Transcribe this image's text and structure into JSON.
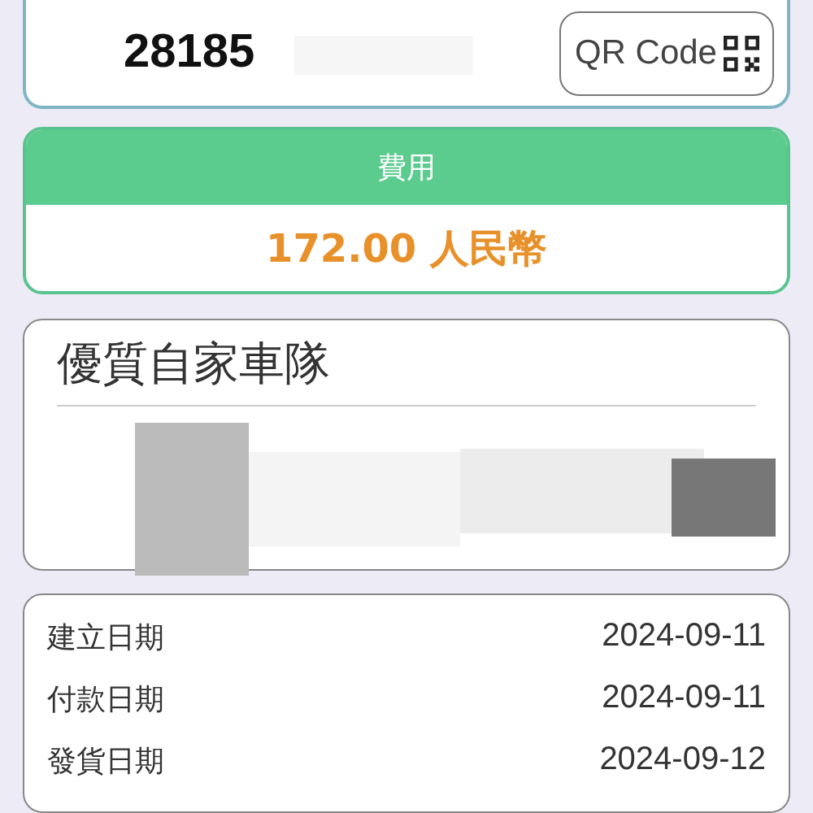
{
  "order": {
    "number": "28185",
    "qr_button": "QR Code"
  },
  "fee": {
    "title": "費用",
    "amount": "172.00 人民幣"
  },
  "carrier": {
    "title": "優質自家車隊"
  },
  "dates": [
    {
      "label": "建立日期",
      "value": "2024-09-11"
    },
    {
      "label": "付款日期",
      "value": "2024-09-11"
    },
    {
      "label": "發貨日期",
      "value": "2024-09-12"
    }
  ]
}
